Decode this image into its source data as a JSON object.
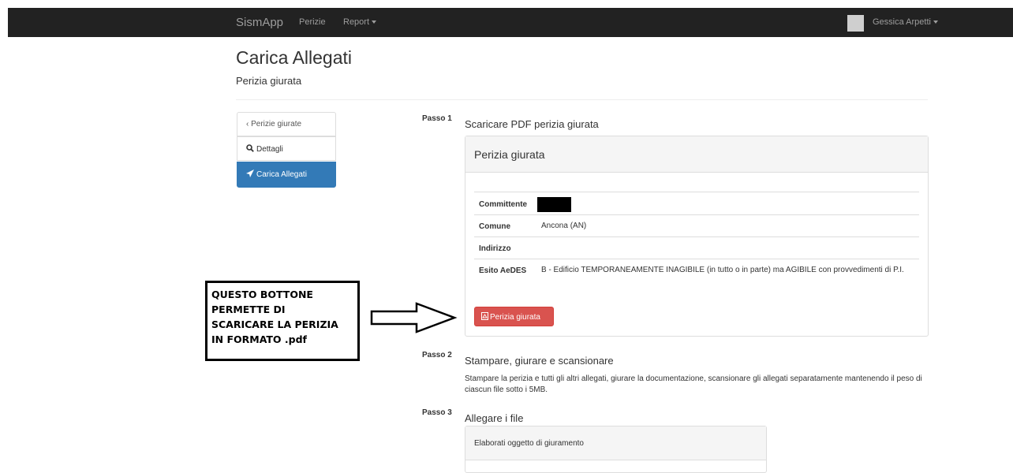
{
  "navbar": {
    "brand": "SismApp",
    "items": [
      {
        "label": "Perizie"
      },
      {
        "label": "Report"
      }
    ],
    "user": "Gessica Arpetti"
  },
  "header": {
    "title": "Carica Allegati",
    "subtitle": "Perizia giurata"
  },
  "sidebar": {
    "items": [
      {
        "label": "‹ Perizie giurate"
      },
      {
        "label": "Dettagli",
        "icon": "search-icon"
      },
      {
        "label": "Carica Allegati",
        "icon": "send-icon",
        "active": true
      }
    ],
    "active_color": "#337ab7"
  },
  "steps": [
    {
      "label": "Passo 1",
      "title": "Scaricare PDF perizia giurata"
    },
    {
      "label": "Passo 2",
      "title": "Stampare, giurare e scansionare",
      "text": "Stampare la perizia e tutti gli altri allegati, giurare la documentazione, scansionare gli allegati separatamente mantenendo il peso di ciascun file sotto i 5MB."
    },
    {
      "label": "Passo 3",
      "title": "Allegare i file"
    }
  ],
  "perizia_panel": {
    "title": "Perizia giurata",
    "rows": [
      {
        "key": "Committente",
        "value": ""
      },
      {
        "key": "Comune",
        "value": "Ancona (AN)"
      },
      {
        "key": "Indirizzo",
        "value": ""
      },
      {
        "key": "Esito AeDES",
        "value": "B - Edificio TEMPORANEAMENTE INAGIBILE (in tutto o in parte) ma AGIBILE con provvedimenti di P.I."
      }
    ],
    "button_label": "Perizia giurata",
    "button_color": "#d9534f"
  },
  "allegati_panel": {
    "title": "Elaborati oggetto di giuramento"
  },
  "annotation": {
    "lines": [
      "QUESTO BOTTONE",
      "PERMETTE DI",
      "SCARICARE LA PERIZIA",
      "IN FORMATO .pdf"
    ]
  }
}
